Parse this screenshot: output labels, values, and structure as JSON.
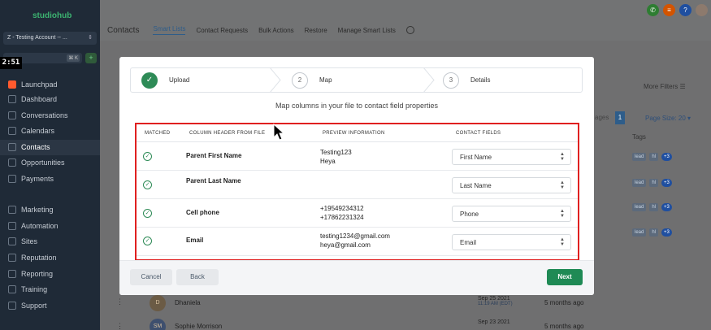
{
  "sidebar": {
    "logo": "studiohub",
    "account": "Z - Testing Account -- ...",
    "search_shortcut": "⌘ K",
    "timer": "2:51",
    "items": [
      {
        "label": "Launchpad",
        "icon": "rocket-icon"
      },
      {
        "label": "Dashboard",
        "icon": "dashboard-icon"
      },
      {
        "label": "Conversations",
        "icon": "chat-icon"
      },
      {
        "label": "Calendars",
        "icon": "calendar-icon"
      },
      {
        "label": "Contacts",
        "icon": "contacts-icon"
      },
      {
        "label": "Opportunities",
        "icon": "funnel-icon"
      },
      {
        "label": "Payments",
        "icon": "payments-icon"
      },
      {
        "label": "Marketing",
        "icon": "send-icon"
      },
      {
        "label": "Automation",
        "icon": "automation-icon"
      },
      {
        "label": "Sites",
        "icon": "globe-icon"
      },
      {
        "label": "Reputation",
        "icon": "star-icon"
      },
      {
        "label": "Reporting",
        "icon": "chart-icon"
      },
      {
        "label": "Training",
        "icon": "book-icon"
      },
      {
        "label": "Support",
        "icon": "support-icon"
      }
    ]
  },
  "header": {
    "title": "Contacts",
    "tabs": [
      "Smart Lists",
      "Contact Requests",
      "Bulk Actions",
      "Restore",
      "Manage Smart Lists"
    ]
  },
  "background": {
    "more_filters": "More Filters",
    "pages_label": "ages",
    "page_num": "1",
    "page_size": "Page Size: 20",
    "tags_header": "Tags",
    "tag1": "lead",
    "tag2": "hl",
    "tag_more": "+3",
    "rows": [
      {
        "initial": "D",
        "name": "Dhaniela",
        "date": "Sep 25 2021",
        "time": "11:19 AM (EDT)",
        "ago": "5 months ago"
      },
      {
        "initial": "SM",
        "name": "Sophie Morrison",
        "date": "Sep 23 2021",
        "time": "",
        "ago": "5 months ago"
      }
    ]
  },
  "modal": {
    "steps": [
      {
        "label": "Upload",
        "num": "✓"
      },
      {
        "label": "Map",
        "num": "2"
      },
      {
        "label": "Details",
        "num": "3"
      }
    ],
    "subtitle": "Map columns in your file to contact field properties",
    "columns": [
      "MATCHED",
      "COLUMN HEADER FROM FILE",
      "PREVIEW INFORMATION",
      "CONTACT FIELDS"
    ],
    "rows": [
      {
        "column": "Parent First Name",
        "preview1": "Testing123",
        "preview2": "Heya",
        "field": "First Name"
      },
      {
        "column": "Parent Last Name",
        "preview1": "",
        "preview2": "",
        "field": "Last Name"
      },
      {
        "column": "Cell phone",
        "preview1": "+19549234312",
        "preview2": "+17862231324",
        "field": "Phone"
      },
      {
        "column": "Email",
        "preview1": "testing1234@gmail.com",
        "preview2": "heya@gmail.com",
        "field": "Email"
      }
    ],
    "cancel": "Cancel",
    "back": "Back",
    "next": "Next"
  }
}
